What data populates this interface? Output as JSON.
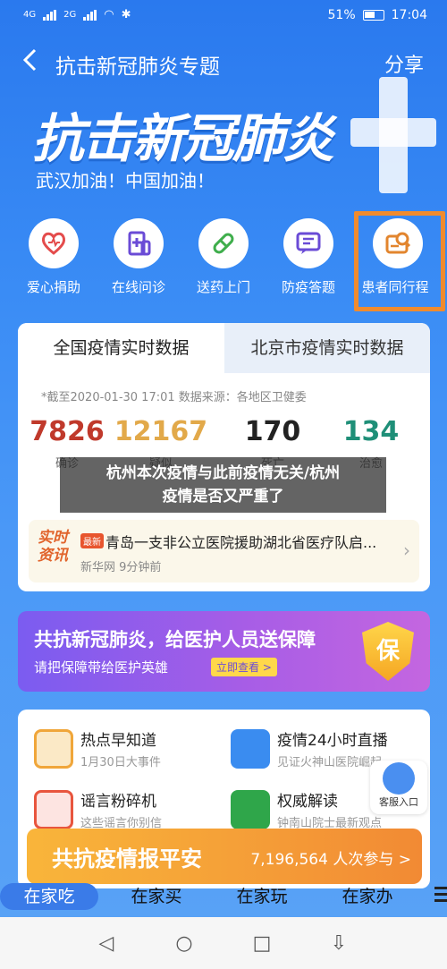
{
  "status_bar": {
    "left_net1": "4G",
    "left_net2": "2G",
    "battery": "51%",
    "time": "17:04"
  },
  "nav": {
    "title": "抗击新冠肺炎专题",
    "share": "分享"
  },
  "hero": {
    "title": "抗击新冠肺炎",
    "subtitle": "武汉加油！中国加油！"
  },
  "quick_menu": [
    {
      "label": "爱心捐助",
      "icon": "heart-icon"
    },
    {
      "label": "在线问诊",
      "icon": "clinic-icon"
    },
    {
      "label": "送药上门",
      "icon": "pill-icon"
    },
    {
      "label": "防疫答题",
      "icon": "quiz-icon"
    },
    {
      "label": "患者同行程",
      "icon": "trip-search-icon"
    }
  ],
  "data_card": {
    "tab_national": "全国疫情实时数据",
    "tab_beijing": "北京市疫情实时数据",
    "update_note": "*截至2020-01-30 17:01 数据来源：各地区卫健委",
    "stats": [
      {
        "value": "7826",
        "label": "确诊",
        "color": "#c0392b"
      },
      {
        "value": "12167",
        "label": "疑似",
        "color": "#e2a94a"
      },
      {
        "value": "170",
        "label": "死亡",
        "color": "#222222"
      },
      {
        "value": "134",
        "label": "治愈",
        "color": "#1f8f78"
      }
    ],
    "news": {
      "tag": "实时资讯",
      "badge": "最新",
      "title": "青岛一支非公立医院援助湖北省医疗队启...",
      "meta": "新华网 9分钟前"
    }
  },
  "overlay": {
    "line1": "杭州本次疫情与此前疫情无关/杭州",
    "line2": "疫情是否又严重了"
  },
  "insurance": {
    "title": "共抗新冠肺炎，给医护人员送保障",
    "subtitle": "请把保障带给医护英雄",
    "cta": "立即查看 >",
    "shield": "保"
  },
  "features": [
    {
      "title": "热点早知道",
      "desc": "1月30日大事件",
      "icon": "hot-news-icon"
    },
    {
      "title": "疫情24小时直播",
      "desc": "见证火神山医院崛起",
      "icon": "live-video-icon"
    },
    {
      "title": "谣言粉碎机",
      "desc": "这些谣言你别信",
      "icon": "rumor-icon"
    },
    {
      "title": "权威解读",
      "desc": "钟南山院士最新观点",
      "icon": "expert-icon"
    }
  ],
  "service": {
    "label": "客服入口"
  },
  "report": {
    "title": "共抗疫情报平安",
    "count": "7,196,564 人次参与 >"
  },
  "bottom_tabs": [
    "在家吃",
    "在家买",
    "在家玩",
    "在家办"
  ]
}
